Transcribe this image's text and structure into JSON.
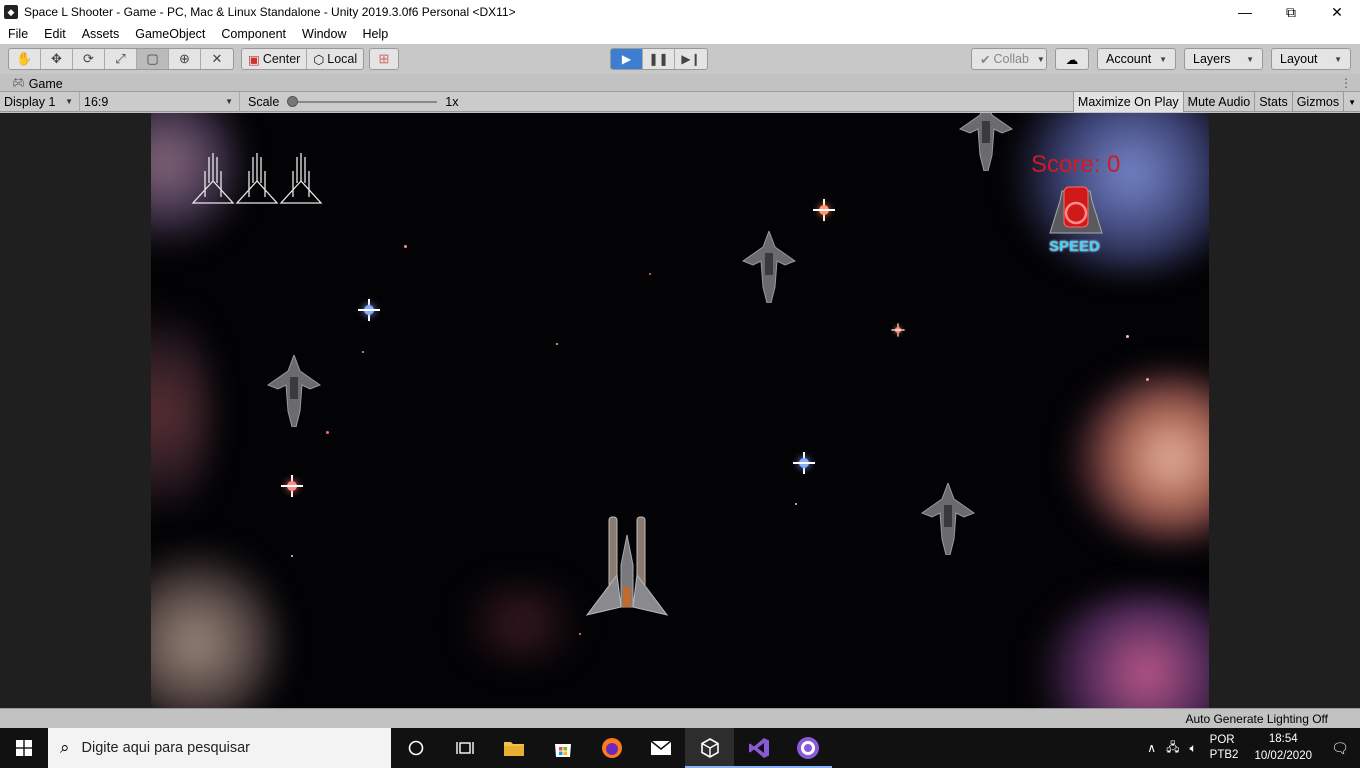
{
  "window": {
    "title": "Space L Shooter - Game - PC, Mac & Linux Standalone - Unity 2019.3.0f6 Personal <DX11>",
    "minimize": "—",
    "maximize": "⧉",
    "close": "✕"
  },
  "menu": [
    "File",
    "Edit",
    "Assets",
    "GameObject",
    "Component",
    "Window",
    "Help"
  ],
  "toolbar": {
    "center_label": "Center",
    "local_label": "Local",
    "collab_label": "Collab",
    "account_label": "Account",
    "layers_label": "Layers",
    "layout_label": "Layout",
    "play_state": "playing"
  },
  "game_tab": {
    "label": "Game"
  },
  "game_bar": {
    "display": "Display 1",
    "aspect": "16:9",
    "scale_label": "Scale",
    "scale_value": "1x",
    "maximize_on_play": "Maximize On Play",
    "mute_audio": "Mute Audio",
    "stats": "Stats",
    "gizmos": "Gizmos"
  },
  "game": {
    "score_text": "Score: 0",
    "powerup_label": "SPEED",
    "lives": 3,
    "colors": {
      "score": "#d11a25",
      "powerup": "#3fd0ff"
    }
  },
  "status": {
    "text": "Auto Generate Lighting Off"
  },
  "taskbar": {
    "search_placeholder": "Digite aqui para pesquisar",
    "lang_top": "POR",
    "lang_bottom": "PTB2",
    "time": "18:54",
    "date": "10/02/2020"
  }
}
